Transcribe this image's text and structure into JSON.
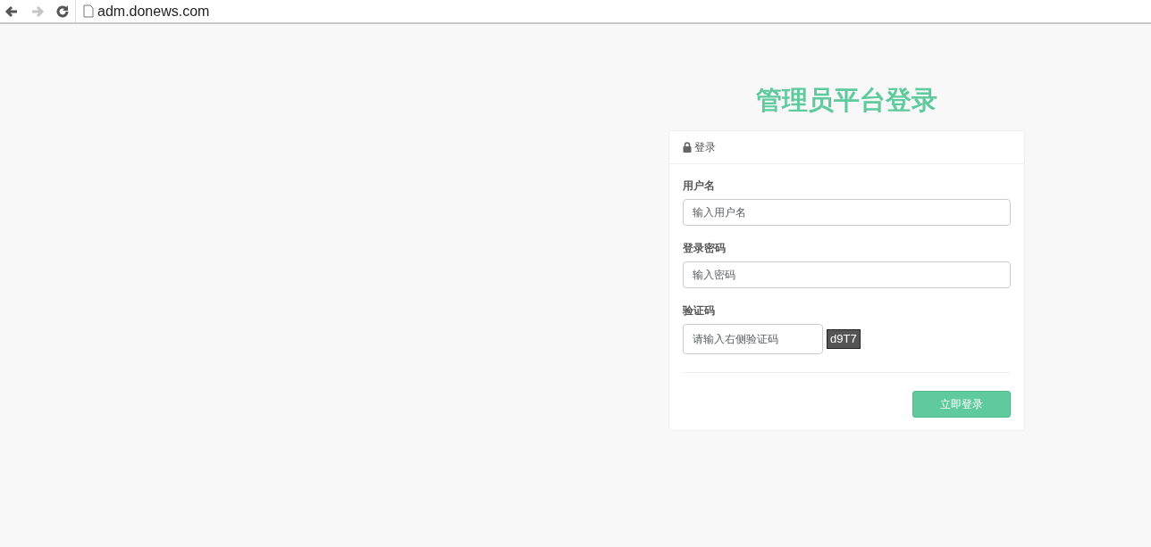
{
  "browser": {
    "nav_buttons": [
      {
        "kind": "back",
        "disabled": false
      },
      {
        "kind": "forward",
        "disabled": true
      },
      {
        "kind": "reload",
        "disabled": false
      }
    ],
    "url": "adm.donews.com"
  },
  "page_title": "管理员平台登录",
  "panel": {
    "heading": "登录",
    "fields": [
      {
        "kind": "text",
        "label": "用户名",
        "placeholder": "输入用户名"
      },
      {
        "kind": "password",
        "label": "登录密码",
        "placeholder": "输入密码"
      },
      {
        "kind": "captcha",
        "label": "验证码",
        "placeholder": "请输入右侧验证码",
        "captcha_text": "d9T7"
      }
    ],
    "submit": "立即登录"
  }
}
